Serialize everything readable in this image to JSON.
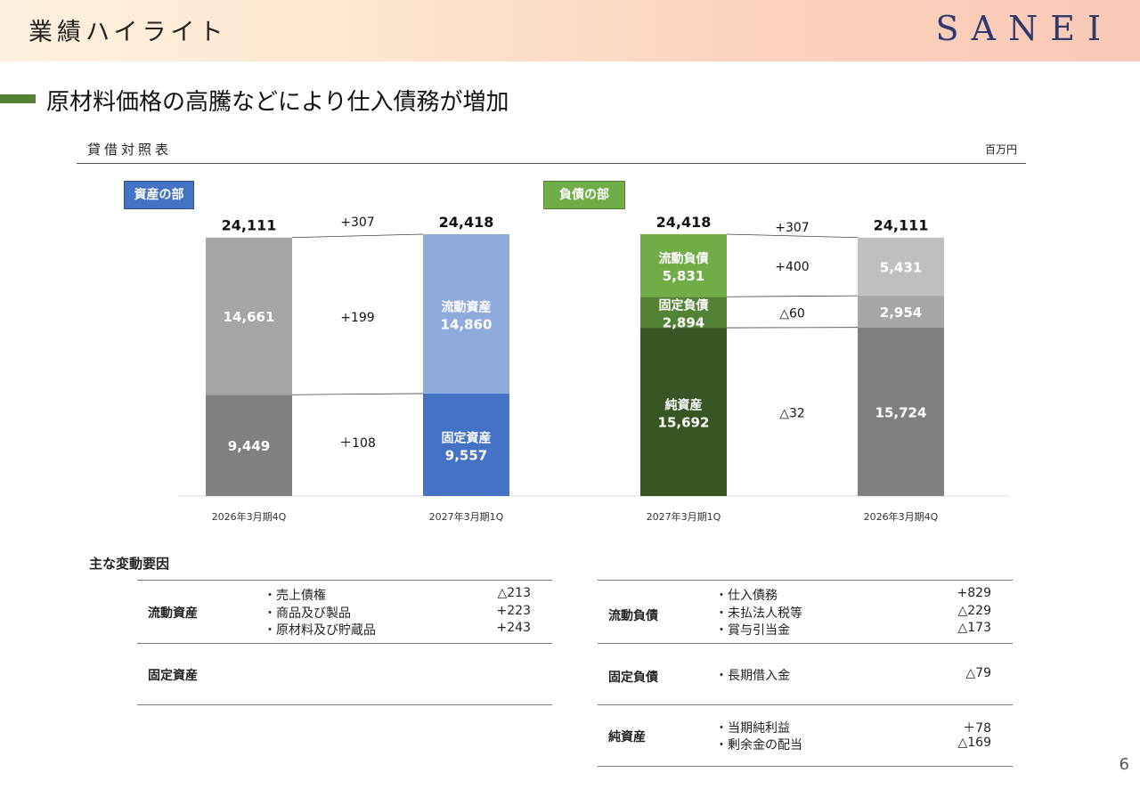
{
  "header": {
    "title": "業績ハイライト",
    "logo": "SANEI"
  },
  "subtitle": "原材料価格の高騰などにより仕入債務が増加",
  "balance_sheet": {
    "label": "貸借対照表",
    "unit": "百万円",
    "assets_tag": "資産の部",
    "liabilities_tag": "負債の部"
  },
  "chart_data": {
    "type": "bar",
    "panels": [
      {
        "name": "資産の部",
        "bars": [
          {
            "category": "2026年3月期4Q",
            "total": "24,111",
            "segments": [
              {
                "label": "",
                "value": 9449,
                "text": "9,449",
                "color": "#808080"
              },
              {
                "label": "",
                "value": 14661,
                "text": "14,661",
                "color": "#a6a6a6"
              }
            ]
          },
          {
            "category": "2027年3月期1Q",
            "total": "24,418",
            "segments": [
              {
                "label": "固定資産",
                "value": 9557,
                "text": "9,557",
                "color": "#4472c4"
              },
              {
                "label": "流動資産",
                "value": 14860,
                "text": "14,860",
                "color": "#8faadc"
              }
            ]
          }
        ],
        "changes": [
          "+307",
          "+199",
          "＋108"
        ]
      },
      {
        "name": "負債の部",
        "bars": [
          {
            "category": "2027年3月期1Q",
            "total": "24,418",
            "segments": [
              {
                "label": "純資産",
                "value": 15692,
                "text": "15,692",
                "color": "#375623"
              },
              {
                "label": "固定負債",
                "value": 2894,
                "text": "2,894",
                "color": "#548235"
              },
              {
                "label": "流動負債",
                "value": 5831,
                "text": "5,831",
                "color": "#70ad47"
              }
            ]
          },
          {
            "category": "2026年3月期4Q",
            "total": "24,111",
            "segments": [
              {
                "label": "",
                "value": 15724,
                "text": "15,724",
                "color": "#808080"
              },
              {
                "label": "",
                "value": 2954,
                "text": "2,954",
                "color": "#a6a6a6"
              },
              {
                "label": "",
                "value": 5431,
                "text": "5,431",
                "color": "#bfbfbf"
              }
            ]
          }
        ],
        "changes": [
          "+307",
          "+400",
          "△60",
          "△32"
        ]
      }
    ]
  },
  "factors": {
    "title": "主な変動要因",
    "left": [
      {
        "category": "流動資産",
        "items": [
          {
            "name": "・売上債権",
            "value": "△213"
          },
          {
            "name": "・商品及び製品",
            "value": "+223"
          },
          {
            "name": "・原材料及び貯蔵品",
            "value": "+243"
          }
        ]
      },
      {
        "category": "固定資産",
        "items": []
      }
    ],
    "right": [
      {
        "category": "流動負債",
        "items": [
          {
            "name": "・仕入債務",
            "value": "+829"
          },
          {
            "name": "・未払法人税等",
            "value": "△229"
          },
          {
            "name": "・賞与引当金",
            "value": "△173"
          }
        ]
      },
      {
        "category": "固定負債",
        "items": [
          {
            "name": "・長期借入金",
            "value": "△79"
          }
        ]
      },
      {
        "category": "純資産",
        "items": [
          {
            "name": "・当期純利益",
            "value": "＋78"
          },
          {
            "name": "・剰余金の配当",
            "value": "△169"
          }
        ]
      }
    ]
  },
  "page_number": "6"
}
